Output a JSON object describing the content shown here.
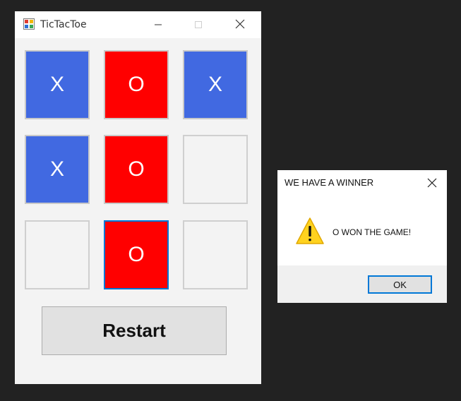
{
  "main_window": {
    "title": "TicTacToe",
    "app_icon": "tictactoe-app-icon",
    "controls": {
      "minimize_icon": "minimize-icon",
      "maximize_icon": "maximize-icon",
      "close_icon": "close-icon"
    }
  },
  "board": {
    "cells": [
      {
        "mark": "X",
        "state": "x"
      },
      {
        "mark": "O",
        "state": "o"
      },
      {
        "mark": "X",
        "state": "x"
      },
      {
        "mark": "X",
        "state": "x"
      },
      {
        "mark": "O",
        "state": "o"
      },
      {
        "mark": "",
        "state": "empty"
      },
      {
        "mark": "",
        "state": "empty"
      },
      {
        "mark": "O",
        "state": "o",
        "focused": true
      },
      {
        "mark": "",
        "state": "empty"
      }
    ],
    "colors": {
      "x": "#4169e1",
      "o": "#ff0000",
      "empty": "#f3f3f3"
    }
  },
  "restart_button": {
    "label": "Restart"
  },
  "dialog": {
    "title": "WE HAVE A WINNER",
    "message": "O WON THE GAME!",
    "icon": "warning-icon",
    "ok_label": "OK",
    "accent": "#0078d7"
  }
}
